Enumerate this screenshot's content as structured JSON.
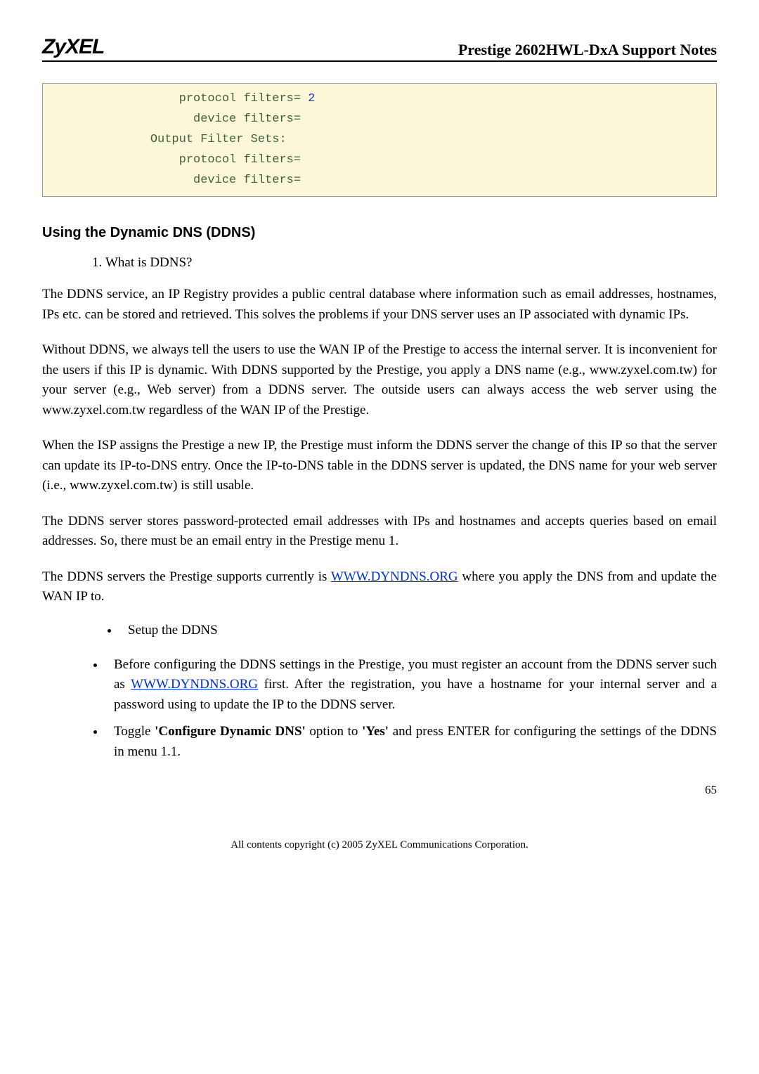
{
  "header": {
    "logo": "ZyXEL",
    "title": "Prestige 2602HWL-DxA Support Notes"
  },
  "codebox": {
    "l1_pre": "                  protocol filters= ",
    "l1_val": "2",
    "l2": "                    device filters=",
    "l3": "              Output Filter Sets:",
    "l4": "                  protocol filters=",
    "l5": "                    device filters="
  },
  "section_heading": "Using the Dynamic DNS (DDNS)",
  "ol_item1": "What is DDNS?",
  "p1": "The DDNS service, an IP Registry provides a public central database where information such as email addresses, hostnames, IPs etc. can be stored and retrieved. This solves the problems if your DNS server uses an IP associated with dynamic IPs.",
  "p2": "Without DDNS, we always tell the users to use the WAN IP of the Prestige to access the internal server. It is inconvenient for the users if this IP is dynamic. With DDNS supported by the Prestige, you apply a DNS name (e.g., www.zyxel.com.tw) for your server (e.g., Web server) from a DDNS server. The outside users can always access the web server using the www.zyxel.com.tw regardless of the WAN IP of the Prestige.",
  "p3": "When the ISP assigns the Prestige a new IP, the Prestige must inform the DDNS server the change of this IP so that the server can update its IP-to-DNS entry. Once the IP-to-DNS table in the DDNS server is updated, the DNS name for your web server (i.e., www.zyxel.com.tw) is still usable.",
  "p4": "The DDNS server stores password-protected email addresses with IPs and hostnames and accepts queries based on email addresses. So, there must be an email entry in the Prestige menu 1.",
  "p5_a": "The DDNS servers the Prestige supports currently is ",
  "p5_link": "WWW.DYNDNS.ORG",
  "p5_b": " where you apply the DNS from and update the WAN IP to.",
  "bullet_solo": "Setup the DDNS",
  "b1_a": "Before configuring the DDNS settings in the Prestige, you must register an account from the DDNS server such as ",
  "b1_link": "WWW.DYNDNS.ORG",
  "b1_b": " first. After the registration, you have a hostname for your internal server and a password using to update the IP to the DDNS server.",
  "b2_a": "Toggle ",
  "b2_bold1": "'Configure Dynamic DNS'",
  "b2_mid": " option to ",
  "b2_bold2": "'Yes'",
  "b2_c": " and press ENTER for configuring the settings of the DDNS in menu 1.1.",
  "footer": "All contents copyright (c) 2005 ZyXEL Communications Corporation.",
  "page_num": "65"
}
